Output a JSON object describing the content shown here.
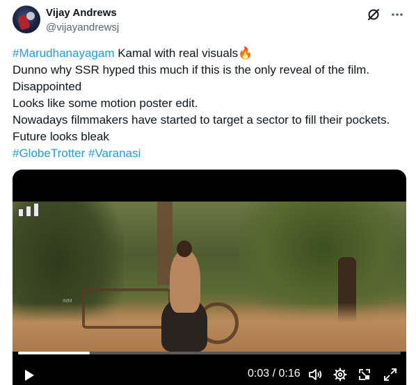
{
  "author": {
    "name": "Vijay Andrews",
    "handle": "@vijayandrewsj"
  },
  "tweet": {
    "lines": [
      {
        "tag": "#Marudhanayagam",
        "text": " Kamal with real visuals🔥"
      },
      {
        "text": "Dunno why SSR hyped this much if this is the only reveal of the film."
      },
      {
        "text": "Disappointed"
      },
      {
        "text": "Looks like some motion poster edit."
      },
      {
        "text": "Nowadays filmmakers have started to target a sector to fill their pockets."
      },
      {
        "text": "Future looks bleak"
      }
    ],
    "hashtags": [
      "#GlobeTrotter",
      "#Varanasi"
    ]
  },
  "video": {
    "time_display": "0:03 / 0:16",
    "progress": 0.1875,
    "watermark": "IMM"
  },
  "icons": {
    "grok": "grok-icon",
    "more": "more-icon",
    "play": "play-icon",
    "volume": "volume-icon",
    "settings": "gear-icon",
    "pip": "picture-in-picture-icon",
    "fullscreen": "fullscreen-icon"
  },
  "colors": {
    "link": "#1d9bf0",
    "text": "#0f1419",
    "secondary": "#536471"
  }
}
